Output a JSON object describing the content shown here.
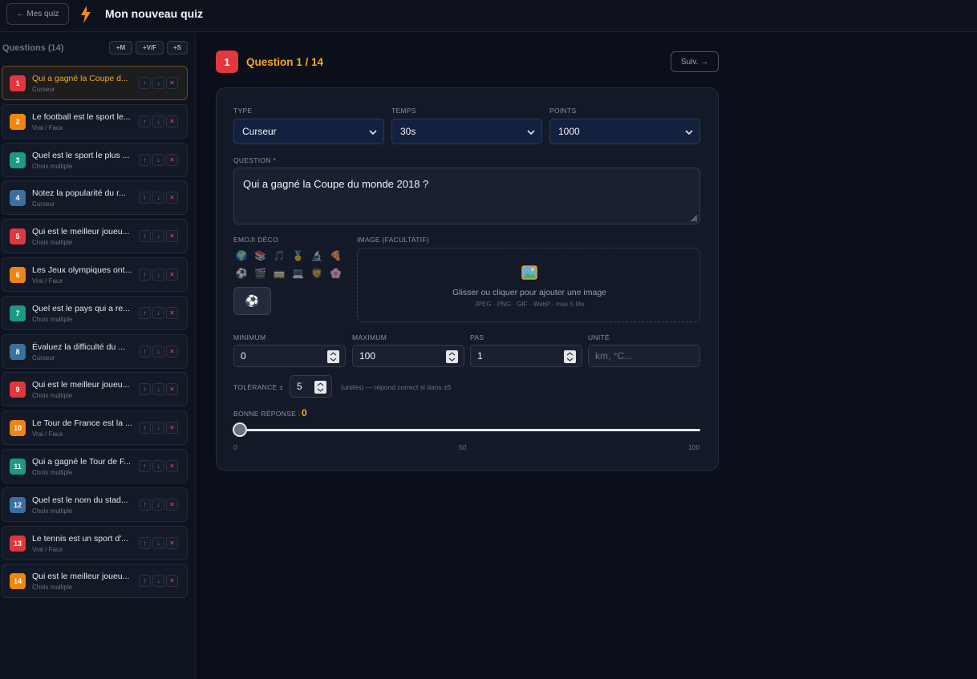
{
  "topbar": {
    "back_label": "← Mes quiz",
    "title": "Mon nouveau quiz"
  },
  "sidebar": {
    "header": "Questions (14)",
    "add_buttons": [
      "+M",
      "+V/F",
      "+S"
    ],
    "controls": {
      "up": "↑",
      "down": "↓",
      "delete": "✕"
    },
    "questions": [
      {
        "num": "1",
        "title": "Qui a gagné la Coupe d...",
        "type": "Curseur",
        "color": "#e0383e"
      },
      {
        "num": "2",
        "title": "Le football est le sport le...",
        "type": "Vrai / Faux",
        "color": "#f0850f"
      },
      {
        "num": "3",
        "title": "Quel est le sport le plus ...",
        "type": "Choix multiple",
        "color": "#1c9a86"
      },
      {
        "num": "4",
        "title": "Notez la popularité du r...",
        "type": "Curseur",
        "color": "#3a6f9e"
      },
      {
        "num": "5",
        "title": "Qui est le meilleur joueu...",
        "type": "Choix multiple",
        "color": "#e0383e"
      },
      {
        "num": "6",
        "title": "Les Jeux olympiques ont...",
        "type": "Vrai / Faux",
        "color": "#f0850f"
      },
      {
        "num": "7",
        "title": "Quel est le pays qui a re...",
        "type": "Choix multiple",
        "color": "#1c9a86"
      },
      {
        "num": "8",
        "title": "Évaluez la difficulté du ...",
        "type": "Curseur",
        "color": "#3a6f9e"
      },
      {
        "num": "9",
        "title": "Qui est le meilleur joueu...",
        "type": "Choix multiple",
        "color": "#e0383e"
      },
      {
        "num": "10",
        "title": "Le Tour de France est la ...",
        "type": "Vrai / Faux",
        "color": "#f0850f"
      },
      {
        "num": "11",
        "title": "Qui a gagné le Tour de F...",
        "type": "Choix multiple",
        "color": "#1c9a86"
      },
      {
        "num": "12",
        "title": "Quel est le nom du stad...",
        "type": "Choix multiple",
        "color": "#3a6f9e"
      },
      {
        "num": "13",
        "title": "Le tennis est un sport d'...",
        "type": "Vrai / Faux",
        "color": "#e0383e"
      },
      {
        "num": "14",
        "title": "Qui est le meilleur joueu...",
        "type": "Choix multiple",
        "color": "#f0850f"
      }
    ]
  },
  "main": {
    "number": "1",
    "heading": "Question 1 / 14",
    "next_label": "Suiv. →",
    "type_label": "TYPE",
    "type_value": "Curseur",
    "time_label": "TEMPS",
    "time_value": "30s",
    "points_label": "POINTS",
    "points_value": "1000",
    "question_label": "QUESTION *",
    "question_value": "Qui a gagné la Coupe du monde 2018 ?",
    "emoji_label": "EMOJI DÉCO",
    "emojis": [
      "🌍",
      "📚",
      "🎵",
      "🏅",
      "🔬",
      "🍕",
      "⚽",
      "🎬",
      "🚃",
      "💻",
      "🦁",
      "🌸"
    ],
    "selected_emoji": "⚽",
    "image_label": "IMAGE (FACULTATIF)",
    "image_icon": "🖼️",
    "image_hint": "Glisser ou cliquer pour ajouter une image",
    "image_formats": "JPEG · PNG · GIF · WebP · max 5 Mo",
    "min_label": "MINIMUM",
    "min_value": "0",
    "max_label": "MAXIMUM",
    "max_value": "100",
    "step_label": "PAS",
    "step_value": "1",
    "unit_label": "UNITÉ",
    "unit_placeholder": "km, °C...",
    "tolerance_label": "TOLÉRANCE ±",
    "tolerance_value": "5",
    "tolerance_note": "(unités) — répond correct si dans ±5",
    "answer_label": "BONNE RÉPONSE :",
    "answer_value": "0",
    "slider_fraction": 0,
    "ticks": [
      "0",
      "50",
      "100"
    ]
  },
  "colors": {
    "accent": "#f6a821",
    "danger": "#e0383e",
    "select_bg": "#13203e"
  }
}
